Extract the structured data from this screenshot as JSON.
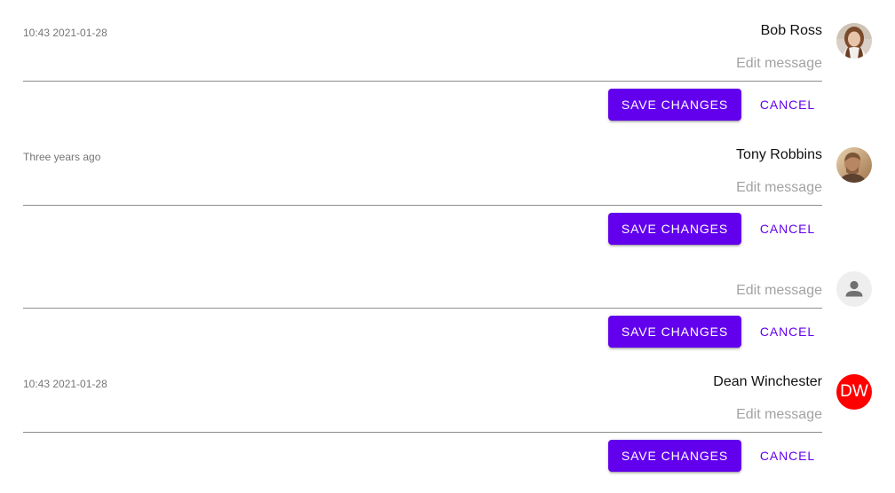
{
  "messages": [
    {
      "timestamp": "10:43 2021-01-28",
      "author": "Bob Ross",
      "avatar": {
        "type": "photo",
        "icon": "woman-portrait-photo"
      },
      "edit_placeholder": "Edit message",
      "save_label": "SAVE CHANGES",
      "cancel_label": "CANCEL"
    },
    {
      "timestamp": "Three years ago",
      "author": "Tony Robbins",
      "avatar": {
        "type": "photo",
        "icon": "man-portrait-photo"
      },
      "edit_placeholder": "Edit message",
      "save_label": "SAVE CHANGES",
      "cancel_label": "CANCEL"
    },
    {
      "timestamp": "",
      "author": "",
      "avatar": {
        "type": "default",
        "icon": "person-icon"
      },
      "edit_placeholder": "Edit message",
      "save_label": "SAVE CHANGES",
      "cancel_label": "CANCEL"
    },
    {
      "timestamp": "10:43 2021-01-28",
      "author": "Dean Winchester",
      "avatar": {
        "type": "initials",
        "initials": "DW",
        "color": "#ff0000"
      },
      "edit_placeholder": "Edit message",
      "save_label": "SAVE CHANGES",
      "cancel_label": "CANCEL"
    }
  ],
  "colors": {
    "primary": "#6200ee",
    "divider": "#8e8e8e",
    "placeholder": "#a3a3a3",
    "timestamp": "#757575"
  }
}
